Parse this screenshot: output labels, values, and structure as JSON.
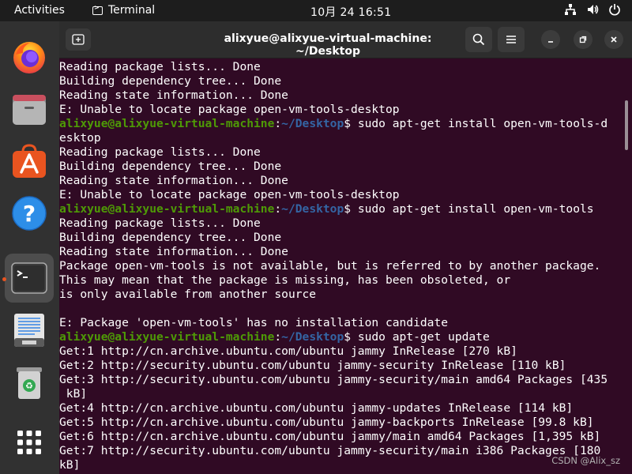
{
  "topbar": {
    "activities_label": "Activities",
    "app_name": "Terminal",
    "clock": "10月 24  16:51",
    "tray_icons": [
      "network-icon",
      "volume-icon",
      "power-icon"
    ]
  },
  "dock": {
    "items": [
      {
        "name": "firefox-icon"
      },
      {
        "name": "files-icon"
      },
      {
        "name": "app-center-icon"
      },
      {
        "name": "help-icon"
      },
      {
        "name": "terminal-icon",
        "active": true
      },
      {
        "name": "text-editor-icon"
      },
      {
        "name": "trash-icon"
      },
      {
        "name": "show-apps-icon"
      }
    ],
    "accent": "#e95420"
  },
  "window": {
    "title": "alixyue@alixyue-virtual-machine: ~/Desktop",
    "background": "#300a24"
  },
  "terminal": {
    "user_host": "alixyue@alixyue-virtual-machine",
    "colon": ":",
    "path": "~/Desktop",
    "lines": [
      {
        "text": "Reading package lists... Done"
      },
      {
        "text": "Building dependency tree... Done"
      },
      {
        "text": "Reading state information... Done"
      },
      {
        "text": "E: Unable to locate package open-vm-tools-desktop"
      },
      {
        "prompt": true,
        "cmd": "$ sudo apt-get install open-vm-tools-d"
      },
      {
        "text": "esktop"
      },
      {
        "text": "Reading package lists... Done"
      },
      {
        "text": "Building dependency tree... Done"
      },
      {
        "text": "Reading state information... Done"
      },
      {
        "text": "E: Unable to locate package open-vm-tools-desktop"
      },
      {
        "prompt": true,
        "cmd": "$ sudo apt-get install open-vm-tools"
      },
      {
        "text": "Reading package lists... Done"
      },
      {
        "text": "Building dependency tree... Done"
      },
      {
        "text": "Reading state information... Done"
      },
      {
        "text": "Package open-vm-tools is not available, but is referred to by another package."
      },
      {
        "text": "This may mean that the package is missing, has been obsoleted, or"
      },
      {
        "text": "is only available from another source"
      },
      {
        "text": ""
      },
      {
        "text": "E: Package 'open-vm-tools' has no installation candidate"
      },
      {
        "prompt": true,
        "cmd": "$ sudo apt-get update"
      },
      {
        "text": "Get:1 http://cn.archive.ubuntu.com/ubuntu jammy InRelease [270 kB]"
      },
      {
        "text": "Get:2 http://security.ubuntu.com/ubuntu jammy-security InRelease [110 kB]"
      },
      {
        "text": "Get:3 http://security.ubuntu.com/ubuntu jammy-security/main amd64 Packages [435"
      },
      {
        "text": " kB]"
      },
      {
        "text": "Get:4 http://cn.archive.ubuntu.com/ubuntu jammy-updates InRelease [114 kB]"
      },
      {
        "text": "Get:5 http://cn.archive.ubuntu.com/ubuntu jammy-backports InRelease [99.8 kB]"
      },
      {
        "text": "Get:6 http://cn.archive.ubuntu.com/ubuntu jammy/main amd64 Packages [1,395 kB]"
      },
      {
        "text": "Get:7 http://security.ubuntu.com/ubuntu jammy-security/main i386 Packages [180"
      },
      {
        "text": "kB]"
      }
    ]
  },
  "watermark": "CSDN @Alix_sz",
  "colors": {
    "prompt_user": "#4e9a06",
    "prompt_path": "#3465a4",
    "topbar": "#1d1d1d",
    "dock": "#313131",
    "headerbar": "#2d2d2d"
  }
}
